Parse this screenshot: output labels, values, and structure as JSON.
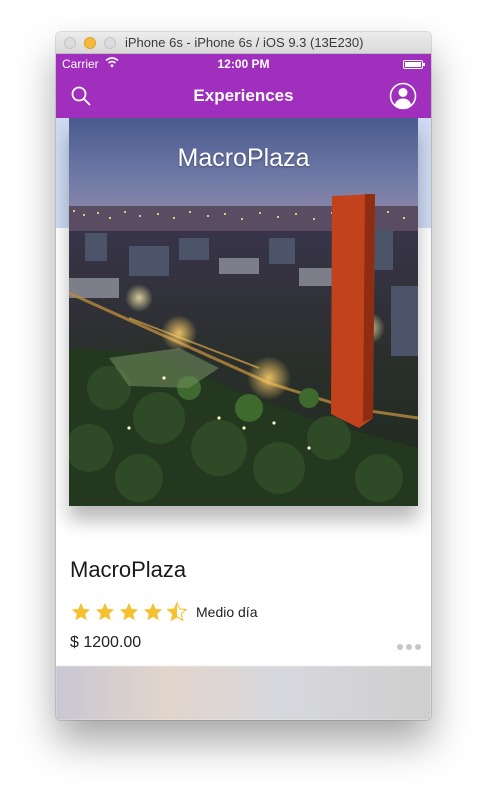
{
  "window": {
    "title": "iPhone 6s - iPhone 6s / iOS 9.3 (13E230)"
  },
  "status_bar": {
    "carrier": "Carrier",
    "time": "12:00 PM"
  },
  "nav": {
    "title": "Experiences",
    "left_icon": "search-icon",
    "right_icon": "profile-icon"
  },
  "experience": {
    "hero_title": "MacroPlaza",
    "name": "MacroPlaza",
    "rating": 4.5,
    "rating_max": 5,
    "duration": "Medio día",
    "price": "$ 1200.00"
  },
  "colors": {
    "brand": "#a12fbd",
    "star": "#f6c131"
  }
}
